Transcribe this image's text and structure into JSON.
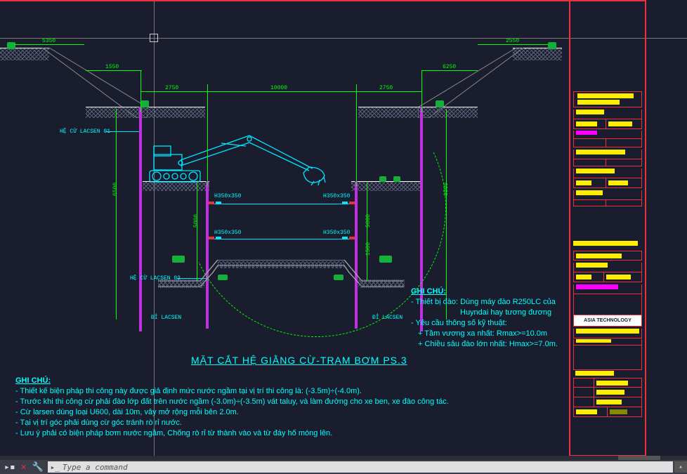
{
  "drawing": {
    "section_title": "MẶT CẮT HỆ GIẰNG CỪ-TRẠM BƠM PS.3",
    "dimensions": {
      "top_left_span": "5350",
      "top_right_span": "2550",
      "inner_left": "1550",
      "inner_right": "6250",
      "span_left": "2750",
      "span_center": "10000",
      "span_right": "2750",
      "height_left": "6500",
      "height_right": "6500",
      "depth_inner_left": "5000",
      "depth_inner_right": "5000",
      "brace_gap": "1500"
    },
    "labels": {
      "pile_sys_1": "HỆ CỪ LACSEN 01",
      "pile_sys_2": "HỆ CỪ LACSEN 02",
      "pile_end": "ĐỈ LACSEN",
      "pile_end_r": "ĐỈ LACSEN",
      "brace_size_1": "H350x350",
      "brace_size_2": "H350x350",
      "brace_size_3": "H350x350",
      "brace_size_4": "H350x350"
    },
    "notes_right": {
      "title": "GHI CHÚ:",
      "line1": "- Thiết bị đào: Dùng máy đào R250LC của",
      "line1b": "Huyndai hay tương đương",
      "line2": "- Yêu cầu thông số kỹ thuật:",
      "line3": "+ Tầm vương xa nhất: Rmax>=10.0m",
      "line4": "+ Chiều sâu đào lớn nhất: Hmax>=7.0m."
    },
    "notes_bottom": {
      "title": "GHI CHÚ:",
      "l1": "- Thiết kế biện pháp thi công này được giả định mức nước ngầm tại vị trí thi công là: (-3.5m)÷(-4.0m).",
      "l2": "- Trước khi thi công cừ phải đào lớp đất trên nước ngầm (-3.0m)÷(-3.5m) vát taluy, và làm đường cho xe ben, xe đào công tác.",
      "l3": "- Cừ larsen dùng loại U600, dài 10m, vây mở rộng mỗi bên 2.0m.",
      "l4": "- Tại vị trí góc phải dùng cừ góc tránh rò rỉ nước.",
      "l5": "- Lưu ý phải có biện pháp bơm nước ngầm, Chống rò rỉ từ thành vào và từ đáy hố móng lên."
    }
  },
  "titleblock": {
    "company": "ASIA TECHNOLOGY"
  },
  "command": {
    "placeholder": "Type a command"
  }
}
